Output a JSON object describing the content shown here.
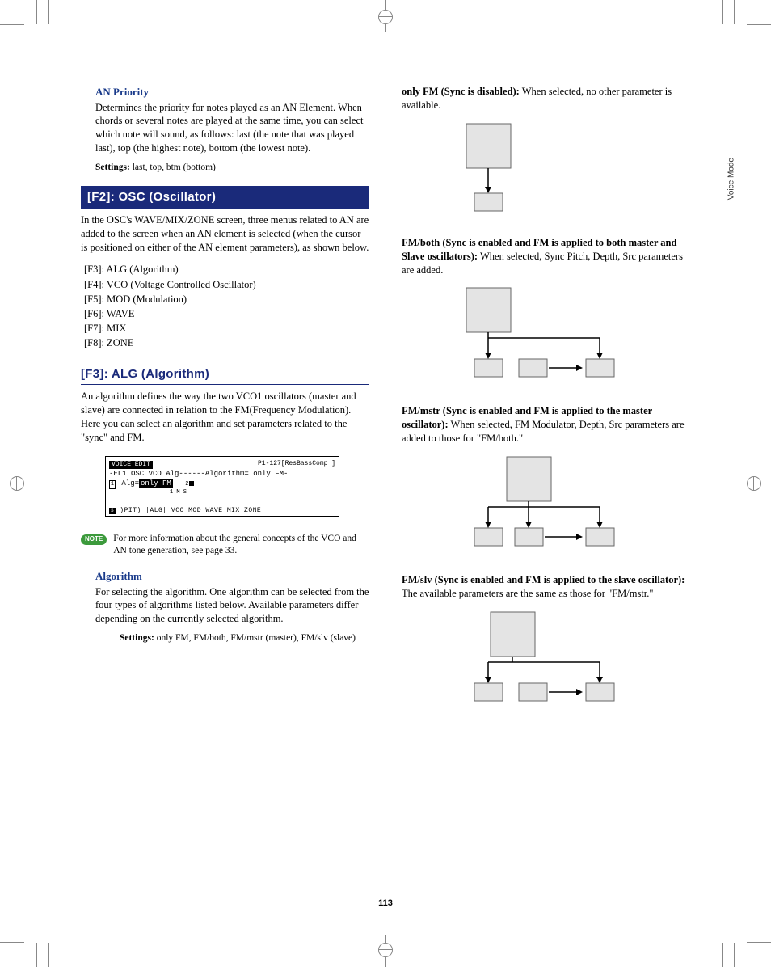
{
  "page_number": "113",
  "side_tab": "Voice Mode",
  "left": {
    "an_priority": {
      "heading": "AN Priority",
      "body": "Determines the priority for notes played as an AN Element. When chords or several notes are played at the same time, you can select which note will sound, as follows: last (the note that was played last), top (the highest note), bottom (the lowest note).",
      "settings_label": "Settings:",
      "settings_val": " last, top, btm (bottom)"
    },
    "f2": {
      "title": "[F2]: OSC (Oscillator)",
      "body": "In the OSC's WAVE/MIX/ZONE screen, three menus related to AN are added to the screen when an AN element is selected (when the cursor is positioned on either of the AN element parameters), as shown below.",
      "list": [
        "[F3]: ALG (Algorithm)",
        "[F4]: VCO (Voltage Controlled Oscillator)",
        "[F5]: MOD (Modulation)",
        "[F6]: WAVE",
        "[F7]: MIX",
        "[F8]: ZONE"
      ]
    },
    "f3": {
      "title": "[F3]: ALG (Algorithm)",
      "body": "An algorithm defines the way the two VCO1 oscillators (master and slave) are connected in relation to the FM(Frequency Modulation). Here you can select an algorithm and set parameters related to the \"sync\" and FM."
    },
    "lcd": {
      "label": "VOICE EDIT",
      "right": "P1-127[ResBassComp ]",
      "line1": "-EL1 OSC VCO Alg------Algorithm= only FM-",
      "alg": "Alg=",
      "algval": "only FM",
      "row2_nums_a": "2",
      "row2_nums_b": "1 M  S",
      "bottom_row": " )PIT)    |ALG| VCO  MOD  WAVE MIX ZONE"
    },
    "note": {
      "badge": "NOTE",
      "text": "For more information about the general concepts of the VCO and AN tone generation, see page 33."
    },
    "algorithm": {
      "heading": "Algorithm",
      "body": "For selecting the algorithm. One algorithm can be selected from the four types of algorithms listed below. Available parameters differ depending on the currently selected algorithm.",
      "settings_label": "Settings:",
      "settings_val": " only FM, FM/both, FM/mstr (master), FM/slv (slave)"
    }
  },
  "right": {
    "only_fm": {
      "head": "only FM (Sync is disabled):",
      "tail": " When selected, no other parameter is available."
    },
    "fm_both": {
      "head": "FM/both (Sync is enabled and FM is applied to both master and Slave oscillators):",
      "tail": " When selected, Sync Pitch, Depth, Src parameters are added."
    },
    "fm_mstr": {
      "head": "FM/mstr (Sync is enabled and FM is applied to the master oscillator):",
      "tail": " When selected, FM Modulator, Depth, Src parameters are added to those for \"FM/both.\""
    },
    "fm_slv": {
      "head": "FM/slv (Sync is enabled and FM is applied to the slave oscillator):",
      "tail": " The available parameters are the same as those for \"FM/mstr.\""
    }
  }
}
